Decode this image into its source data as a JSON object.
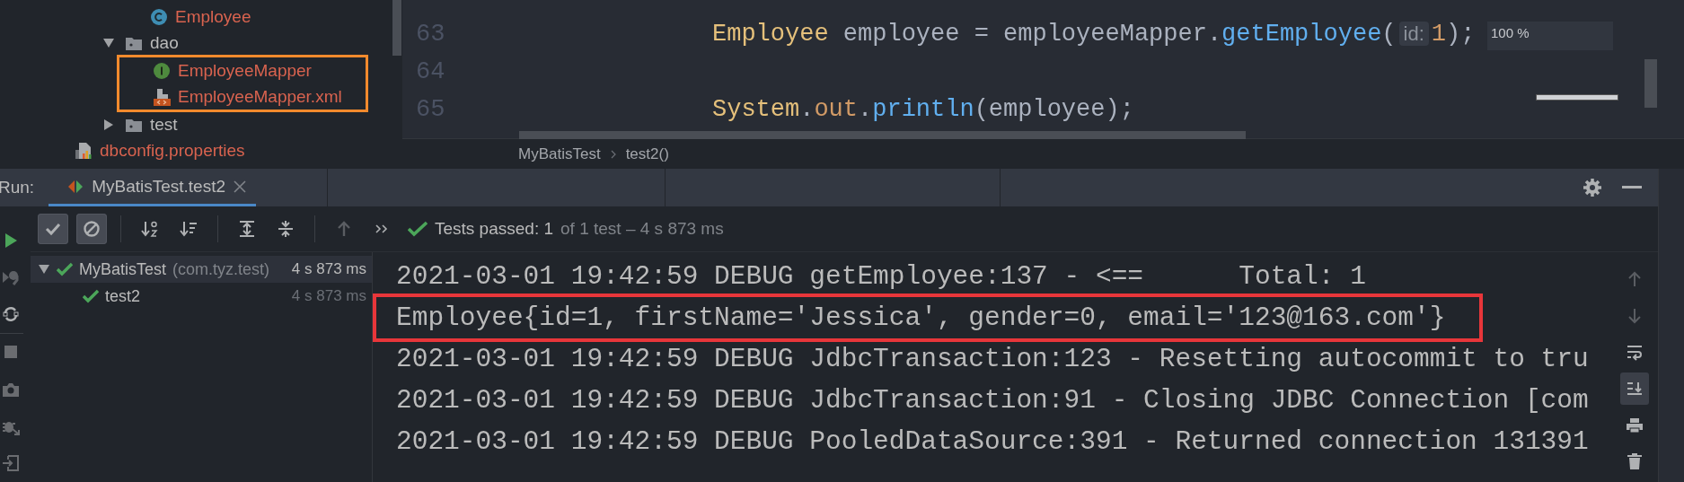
{
  "project_tree": {
    "items": [
      {
        "kind": "hidden",
        "children": [
          {
            "kind": "hidden",
            "children": [
              {
                "kind": "hidden",
                "children": [
                  {
                    "kind": "class",
                    "label": "Employee",
                    "color": "#d9634f",
                    "highlighted": false
                  }
                ]
              },
              {
                "kind": "folder",
                "label": "dao",
                "color": "#bbbbbb",
                "expanded": true,
                "highlighted": false,
                "children": [
                  {
                    "kind": "interface",
                    "label": "EmployeeMapper",
                    "color": "#d9634f",
                    "highlighted": true
                  },
                  {
                    "kind": "xml",
                    "label": "EmployeeMapper.xml",
                    "color": "#d9634f",
                    "highlighted": true
                  }
                ]
              },
              {
                "kind": "folder",
                "label": "test",
                "color": "#bbbbbb",
                "expanded": false,
                "highlighted": false
              }
            ]
          }
        ]
      },
      {
        "kind": "properties",
        "label": "dbconfig.properties",
        "color": "#d9634f",
        "highlighted": false
      }
    ]
  },
  "editor": {
    "lines": [
      {
        "number": "63",
        "tokens": [
          {
            "kind": "type",
            "text": "Employee"
          },
          {
            "kind": "plain",
            "text": " employee = employeeMapper."
          },
          {
            "kind": "method",
            "text": "getEmployee"
          },
          {
            "kind": "plain",
            "text": "("
          },
          {
            "kind": "hint",
            "text": "id:"
          },
          {
            "kind": "number",
            "text": "1"
          },
          {
            "kind": "plain",
            "text": ");"
          }
        ]
      },
      {
        "number": "64"
      },
      {
        "number": "65",
        "tokens": [
          {
            "kind": "type",
            "text": "System"
          },
          {
            "kind": "plain",
            "text": "."
          },
          {
            "kind": "field",
            "text": "out"
          },
          {
            "kind": "plain",
            "text": "."
          },
          {
            "kind": "method",
            "text": "println"
          },
          {
            "kind": "plain",
            "text": "(employee);"
          }
        ]
      }
    ],
    "zoom_popup": "100 %",
    "breadcrumbs": [
      "MyBatisTest",
      "test2()"
    ]
  },
  "run_panel": {
    "label": "Run:",
    "tabs": [
      {
        "label": "MyBatisTest.test2",
        "selected": true
      }
    ],
    "side_tools": [
      {
        "kind": "run"
      },
      {
        "kind": "rerun-failed"
      },
      {
        "kind": "toggle-auto"
      },
      {
        "kind": "separator"
      },
      {
        "kind": "stop"
      },
      {
        "kind": "snapshot"
      },
      {
        "kind": "export"
      },
      {
        "kind": "exit"
      }
    ],
    "toolbar": [
      {
        "kind": "show-passed",
        "pressed": true
      },
      {
        "kind": "show-ignored",
        "pressed": true
      },
      {
        "kind": "separator"
      },
      {
        "kind": "sort-alpha",
        "pressed": false
      },
      {
        "kind": "sort-duration",
        "pressed": false
      },
      {
        "kind": "separator"
      },
      {
        "kind": "expand-all",
        "pressed": false
      },
      {
        "kind": "collapse-all",
        "pressed": false
      },
      {
        "kind": "separator"
      },
      {
        "kind": "previous",
        "pressed": false
      },
      {
        "kind": "more",
        "pressed": false
      }
    ],
    "status": {
      "passed": "Tests passed: 1",
      "detail": "of 1 test – 4 s 873 ms"
    },
    "test_tree": [
      {
        "name": "MyBatisTest",
        "package": "(com.tyz.test)",
        "time": "4 s 873 ms",
        "expanded": true,
        "selected": true,
        "children": [
          {
            "name": "test2",
            "time": "4 s 873 ms",
            "selected": false
          }
        ]
      }
    ],
    "console": {
      "lines": [
        {
          "text": "2021-03-01 19:42:59 DEBUG getEmployee:137 - <==      Total: 1",
          "highlighted": false
        },
        {
          "text": "Employee{id=1, firstName='Jessica', gender=0, email='123@163.com'}",
          "highlighted": true
        },
        {
          "text": "2021-03-01 19:42:59 DEBUG JdbcTransaction:123 - Resetting autocommit to tru",
          "highlighted": false
        },
        {
          "text": "2021-03-01 19:42:59 DEBUG JdbcTransaction:91 - Closing JDBC Connection [com",
          "highlighted": false
        },
        {
          "text": "2021-03-01 19:42:59 DEBUG PooledDataSource:391 - Returned connection 131391",
          "highlighted": false
        }
      ]
    },
    "console_tools": [
      {
        "kind": "up",
        "selected": false
      },
      {
        "kind": "down",
        "selected": false
      },
      {
        "kind": "soft-wrap",
        "selected": false
      },
      {
        "kind": "scroll-end",
        "selected": true
      },
      {
        "kind": "print",
        "selected": false
      },
      {
        "kind": "clear",
        "selected": false
      }
    ]
  }
}
